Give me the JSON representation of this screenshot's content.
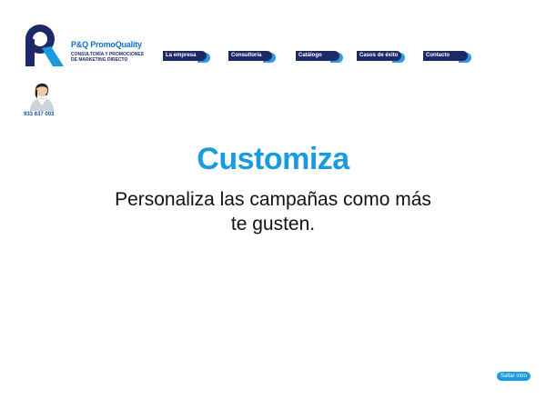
{
  "brand": {
    "name": "P&Q PromoQuality",
    "tagline_line1": "CONSULTORÍA Y PROMOCIONES",
    "tagline_line2": "DE MARKETING DIRECTO"
  },
  "nav": {
    "items": [
      {
        "label": "La empresa"
      },
      {
        "label": "Consultoría"
      },
      {
        "label": "Catálogo"
      },
      {
        "label": "Casos de éxito"
      },
      {
        "label": "Contacto"
      }
    ]
  },
  "contact": {
    "phone": "933 637 003"
  },
  "main": {
    "headline": "Customiza",
    "subtext": "Personaliza las campañas como más te gusten."
  },
  "skip_intro": {
    "label": "Saltar intro"
  },
  "colors": {
    "brand_blue": "#1a9be0",
    "navy": "#1e2a68",
    "accent_light": "#2a9be8"
  }
}
